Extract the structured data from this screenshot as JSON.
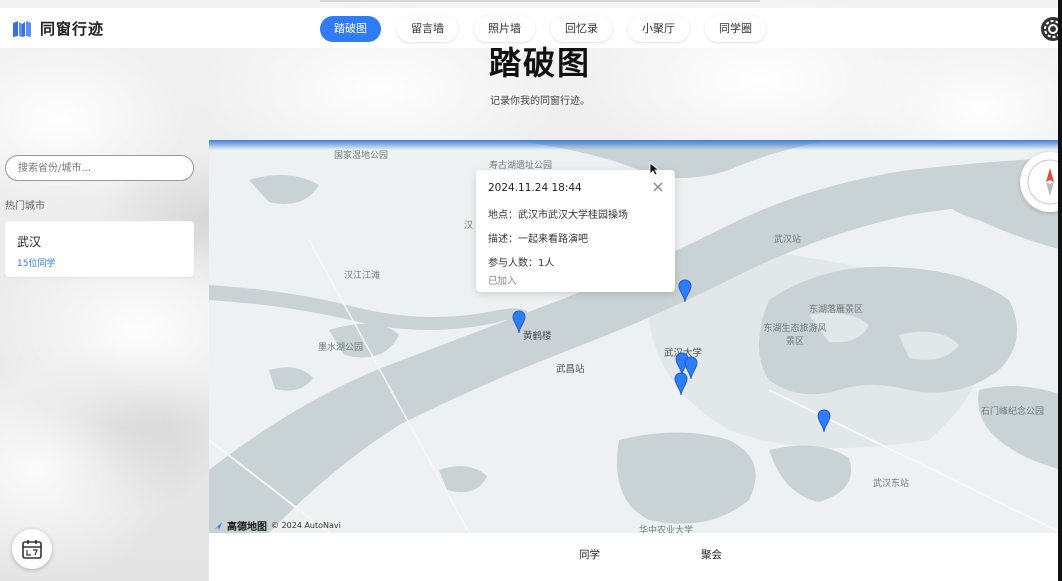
{
  "app": {
    "title": "同窗行迹"
  },
  "nav": {
    "items": [
      {
        "label": "踏破图",
        "active": true
      },
      {
        "label": "留言墙",
        "active": false
      },
      {
        "label": "照片墙",
        "active": false
      },
      {
        "label": "回忆录",
        "active": false
      },
      {
        "label": "小聚厅",
        "active": false
      },
      {
        "label": "同学圈",
        "active": false
      }
    ]
  },
  "page": {
    "title": "踏破图",
    "subtitle": "记录你我的同窗行迹。"
  },
  "sidebar": {
    "search_placeholder": "搜索省份/城市...",
    "hot_cities_label": "热门城市",
    "cities": [
      {
        "name": "武汉",
        "count": "15位同学"
      }
    ]
  },
  "map": {
    "labels": {
      "l1": "国家湿地公园",
      "l2": "寿古湖遗址公园",
      "l3": "汉江江滩",
      "l4": "汉",
      "l5": "黄鹤楼",
      "l6": "墨水湖公园",
      "l7": "武昌站",
      "l8": "武汉大学",
      "l9": "武汉站",
      "l10": "东湖落雁景区",
      "l11": "东湖生态旅游风景区",
      "l12": "石门峰纪念公园",
      "l13": "武汉东站",
      "l14": "华中农业大学"
    },
    "attribution": {
      "logo": "高德地图",
      "copyright": "© 2024 AutoNavi"
    },
    "marker_color": "#2f7cf6"
  },
  "popup": {
    "time": "2024.11.24 18:44",
    "location": "地点：武汉市武汉大学桂园操场",
    "description": "描述：一起来看路演吧",
    "participants": "参与人数：1人",
    "status": "已加入"
  },
  "bottom_tabs": {
    "classmates": "同学",
    "gatherings": "聚会"
  },
  "colors": {
    "accent": "#2f7cf6"
  }
}
